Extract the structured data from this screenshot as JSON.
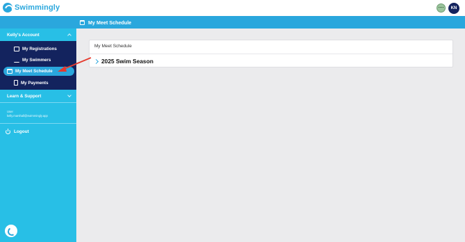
{
  "app": {
    "name": "Swimmingly"
  },
  "topbar": {
    "avatar_initials": "KN"
  },
  "sidebar": {
    "account_title": "Kelly's Account",
    "items": [
      {
        "label": "My Registrations",
        "icon": "card-icon"
      },
      {
        "label": "My Swimmers",
        "icon": "swimmer-icon"
      },
      {
        "label": "My Meet Schedule",
        "icon": "calendar-icon"
      },
      {
        "label": "My Payments",
        "icon": "receipt-icon"
      }
    ],
    "learn_title": "Learn & Support",
    "user_label": "User",
    "user_email": "kelly.marshall@swimmingly.app",
    "logout_label": "Logout"
  },
  "page": {
    "title": "My Meet Schedule",
    "card_title": "My Meet Schedule",
    "season": "2025 Swim Season"
  },
  "colors": {
    "brand_blue": "#2aa7dd",
    "sidebar_cyan": "#28bfe6",
    "nav_dark": "#13235e",
    "annotation_arrow": "#e53a2d"
  }
}
